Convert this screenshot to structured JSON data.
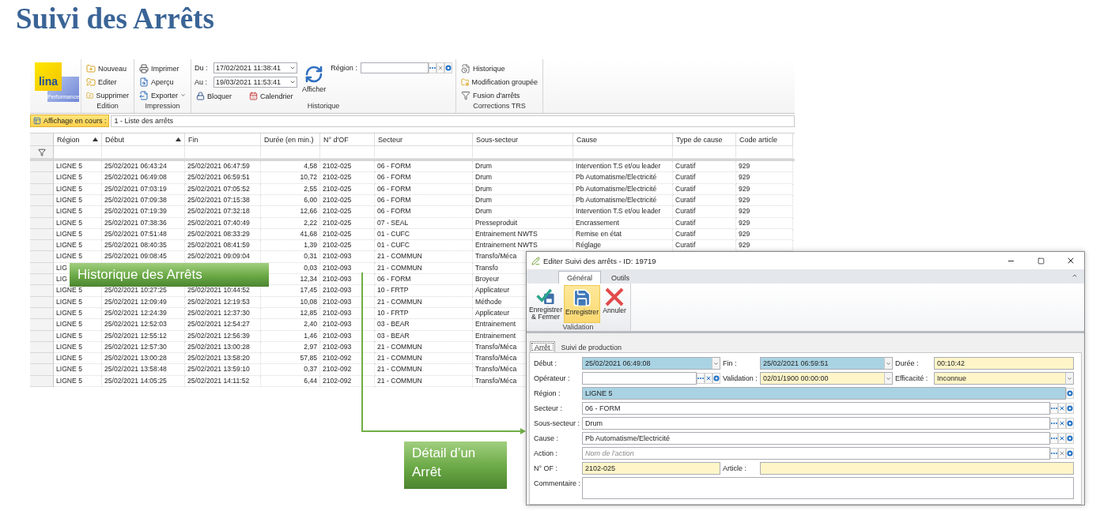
{
  "title": "Suivi des Arrêts",
  "main_window": {
    "logo": {
      "text": "lina",
      "subtext": "Performance"
    },
    "ribbon_groups": [
      {
        "kind": "buttons",
        "label": "Edition",
        "items": [
          {
            "label": "Nouveau",
            "dropdown": false
          },
          {
            "label": "Editer",
            "dropdown": false
          },
          {
            "label": "Supprimer",
            "dropdown": false
          }
        ]
      },
      {
        "kind": "buttons",
        "label": "Impression",
        "items": [
          {
            "label": "Imprimer",
            "dropdown": false
          },
          {
            "label": "Aperçu",
            "dropdown": false
          },
          {
            "label": "Exporter",
            "dropdown": true
          }
        ]
      },
      {
        "kind": "history",
        "label": "Historique",
        "from": {
          "label": "Du :",
          "value": "17/02/2021 11:38:41"
        },
        "to": {
          "label": "Au :",
          "value": "19/03/2021 11:53:41"
        },
        "buttons": [
          {
            "label": "Bloquer"
          },
          {
            "label": "Calendrier"
          }
        ],
        "refresh": {
          "label": "Afficher"
        },
        "region": {
          "label": "Région :"
        }
      },
      {
        "kind": "buttons",
        "label": "Corrections TRS",
        "items": [
          {
            "label": "Historique",
            "dropdown": false
          },
          {
            "label": "Modification groupée",
            "dropdown": false
          },
          {
            "label": "Fusion d'arrêts",
            "dropdown": false
          }
        ]
      }
    ],
    "view_bar": {
      "label": "Affichage en cours :",
      "value": "1 - Liste des arrêts"
    },
    "grid": {
      "columns": [
        {
          "label": "Région",
          "sorted": true
        },
        {
          "label": "Début",
          "sorted": true
        },
        {
          "label": "Fin",
          "sorted": false
        },
        {
          "label": "Durée (en min.)",
          "sorted": false
        },
        {
          "label": "N° d'OF",
          "sorted": false
        },
        {
          "label": "Secteur",
          "sorted": false
        },
        {
          "label": "Sous-secteur",
          "sorted": false
        },
        {
          "label": "Cause",
          "sorted": false
        },
        {
          "label": "Type de cause",
          "sorted": false
        },
        {
          "label": "Code article",
          "sorted": false
        }
      ],
      "rows": [
        {
          "region": "LIGNE 5",
          "debut": "25/02/2021 06:43:24",
          "fin": "25/02/2021 06:47:59",
          "duree": "4,58",
          "of": "2102-025",
          "secteur": "06 - FORM",
          "sous_secteur": "Drum",
          "cause": "Intervention T.S et/ou leader",
          "type": "Curatif",
          "code": "929"
        },
        {
          "region": "LIGNE 5",
          "debut": "25/02/2021 06:49:08",
          "fin": "25/02/2021 06:59:51",
          "duree": "10,72",
          "of": "2102-025",
          "secteur": "06 - FORM",
          "sous_secteur": "Drum",
          "cause": "Pb Automatisme/Electricité",
          "type": "Curatif",
          "code": "929"
        },
        {
          "region": "LIGNE 5",
          "debut": "25/02/2021 07:03:19",
          "fin": "25/02/2021 07:05:52",
          "duree": "2,55",
          "of": "2102-025",
          "secteur": "06 - FORM",
          "sous_secteur": "Drum",
          "cause": "Pb Automatisme/Electricité",
          "type": "Curatif",
          "code": "929"
        },
        {
          "region": "LIGNE 5",
          "debut": "25/02/2021 07:09:38",
          "fin": "25/02/2021 07:15:38",
          "duree": "6,00",
          "of": "2102-025",
          "secteur": "06 - FORM",
          "sous_secteur": "Drum",
          "cause": "Pb Automatisme/Electricité",
          "type": "Curatif",
          "code": "929"
        },
        {
          "region": "LIGNE 5",
          "debut": "25/02/2021 07:19:39",
          "fin": "25/02/2021 07:32:18",
          "duree": "12,66",
          "of": "2102-025",
          "secteur": "06 - FORM",
          "sous_secteur": "Drum",
          "cause": "Intervention T.S et/ou leader",
          "type": "Curatif",
          "code": "929"
        },
        {
          "region": "LIGNE 5",
          "debut": "25/02/2021 07:38:36",
          "fin": "25/02/2021 07:40:49",
          "duree": "2,22",
          "of": "2102-025",
          "secteur": "07 - SEAL",
          "sous_secteur": "Presseproduit",
          "cause": "Encrassement",
          "type": "Curatif",
          "code": "929"
        },
        {
          "region": "LIGNE 5",
          "debut": "25/02/2021 07:51:48",
          "fin": "25/02/2021 08:33:29",
          "duree": "41,68",
          "of": "2102-025",
          "secteur": "01 - CUFC",
          "sous_secteur": "Entrainement NWTS",
          "cause": "Remise en état",
          "type": "Curatif",
          "code": "929"
        },
        {
          "region": "LIGNE 5",
          "debut": "25/02/2021 08:40:35",
          "fin": "25/02/2021 08:41:59",
          "duree": "1,39",
          "of": "2102-025",
          "secteur": "01 - CUFC",
          "sous_secteur": "Entrainement NWTS",
          "cause": "Réglage",
          "type": "Curatif",
          "code": "929"
        },
        {
          "region": "LIGNE 5",
          "debut": "25/02/2021 09:08:45",
          "fin": "25/02/2021 09:09:04",
          "duree": "0,31",
          "of": "2102-093",
          "secteur": "21 - COMMUN",
          "sous_secteur": "Transfo/Méca"
        },
        {
          "region": "LIG",
          "duree": "0,03",
          "of": "2102-093",
          "secteur": "21 - COMMUN",
          "sous_secteur": "Transfo"
        },
        {
          "region": "LIG",
          "duree": "12,34",
          "of": "2102-093",
          "secteur": "06 - FORM",
          "sous_secteur": "Broyeur"
        },
        {
          "region": "LIGNE 5",
          "debut": "25/02/2021 10:27:25",
          "fin": "25/02/2021 10:44:52",
          "duree": "17,45",
          "of": "2102-093",
          "secteur": "10 - FRTP",
          "sous_secteur": "Applicateur"
        },
        {
          "region": "LIGNE 5",
          "debut": "25/02/2021 12:09:49",
          "fin": "25/02/2021 12:19:53",
          "duree": "10,08",
          "of": "2102-093",
          "secteur": "21 - COMMUN",
          "sous_secteur": "Méthode"
        },
        {
          "region": "LIGNE 5",
          "debut": "25/02/2021 12:24:39",
          "fin": "25/02/2021 12:37:30",
          "duree": "12,85",
          "of": "2102-093",
          "secteur": "10 - FRTP",
          "sous_secteur": "Applicateur"
        },
        {
          "region": "LIGNE 5",
          "debut": "25/02/2021 12:52:03",
          "fin": "25/02/2021 12:54:27",
          "duree": "2,40",
          "of": "2102-093",
          "secteur": "03 - BEAR",
          "sous_secteur": "Entrainement"
        },
        {
          "region": "LIGNE 5",
          "debut": "25/02/2021 12:55:12",
          "fin": "25/02/2021 12:56:39",
          "duree": "1,46",
          "of": "2102-093",
          "secteur": "03 - BEAR",
          "sous_secteur": "Entrainement"
        },
        {
          "region": "LIGNE 5",
          "debut": "25/02/2021 12:57:30",
          "fin": "25/02/2021 13:00:28",
          "duree": "2,97",
          "of": "2102-093",
          "secteur": "21 - COMMUN",
          "sous_secteur": "Transfo/Méca"
        },
        {
          "region": "LIGNE 5",
          "debut": "25/02/2021 13:00:28",
          "fin": "25/02/2021 13:58:20",
          "duree": "57,85",
          "of": "2102-092",
          "secteur": "21 - COMMUN",
          "sous_secteur": "Transfo/Méca"
        },
        {
          "region": "LIGNE 5",
          "debut": "25/02/2021 13:58:48",
          "fin": "25/02/2021 13:59:10",
          "duree": "0,37",
          "of": "2102-092",
          "secteur": "21 - COMMUN",
          "sous_secteur": "Transfo/Méca"
        },
        {
          "region": "LIGNE 5",
          "debut": "25/02/2021 14:05:25",
          "fin": "25/02/2021 14:11:52",
          "duree": "6,44",
          "of": "2102-092",
          "secteur": "21 - COMMUN",
          "sous_secteur": "Transfo/Méca"
        }
      ]
    }
  },
  "dialog": {
    "title": "Editer Suivi des arrêts - ID: 19719",
    "ribbon_tabs": [
      {
        "label": "Général",
        "selected": true
      },
      {
        "label": "Outils",
        "selected": false
      }
    ],
    "actions": [
      {
        "label": "Enregistrer & Fermer",
        "selected": false
      },
      {
        "label": "Enregistrer",
        "selected": true
      },
      {
        "label": "Annuler",
        "selected": false
      }
    ],
    "action_group": "Validation",
    "tabs": [
      {
        "label": "Arrêt",
        "selected": true
      },
      {
        "label": "Suivi de production",
        "selected": false
      }
    ],
    "form_rows": [
      [
        {
          "label": "Début :",
          "kind": "date",
          "value": "25/02/2021 06:49:08",
          "color": "#a9d3e3"
        },
        {
          "label": "Fin :",
          "kind": "date",
          "value": "25/02/2021 06:59:51",
          "color": "#a9d3e3"
        },
        {
          "label": "Durée :",
          "kind": "text",
          "value": "00:10:42",
          "color": "#fff5c9"
        }
      ],
      [
        {
          "label": "Opérateur :",
          "kind": "lookup",
          "color": "#ffffff",
          "clear_disabled": false
        },
        {
          "label": "Validation :",
          "kind": "date",
          "value": "02/01/1900 00:00:00",
          "color": "#fff5c9"
        },
        {
          "label": "Efficacité :",
          "kind": "date",
          "value": "Inconnue",
          "color": "#fff5c9"
        }
      ],
      [
        {
          "label": "Région :",
          "kind": "picker",
          "value": "LIGNE 5",
          "color": "#a9d3e3"
        }
      ],
      [
        {
          "label": "Secteur :",
          "kind": "lookup",
          "value": "06 - FORM",
          "color": "#ffffff",
          "clear_disabled": false
        }
      ],
      [
        {
          "label": "Sous-secteur :",
          "kind": "lookup",
          "value": "Drum",
          "color": "#ffffff",
          "clear_disabled": false
        }
      ],
      [
        {
          "label": "Cause :",
          "kind": "lookup",
          "value": "Pb Automatisme/Electricité",
          "color": "#ffffff",
          "clear_disabled": false
        }
      ],
      [
        {
          "label": "Action :",
          "kind": "lookup",
          "placeholder": "Nom de l'action",
          "color": "#ffffff",
          "clear_disabled": true
        }
      ],
      [
        {
          "label": "N° OF :",
          "kind": "text",
          "value": "2102-025",
          "color": "#fff5c9"
        },
        {
          "label": "Article :",
          "kind": "text",
          "color": "#fff5c9"
        }
      ],
      [
        {
          "label": "Commentaire :",
          "kind": "memo",
          "color": "#ffffff"
        }
      ]
    ]
  },
  "callouts": [
    {
      "text": "Historique des Arrêts"
    },
    {
      "text": "Détail d’un Arrêt"
    }
  ]
}
